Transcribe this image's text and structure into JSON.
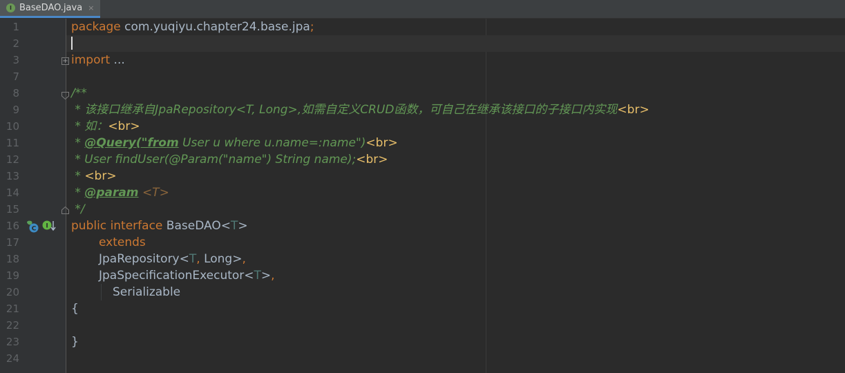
{
  "tab": {
    "label": "BaseDAO.java",
    "icon_letter": "I",
    "close": "×"
  },
  "line_numbers": [
    "1",
    "2",
    "3",
    "7",
    "8",
    "9",
    "10",
    "11",
    "12",
    "13",
    "14",
    "15",
    "16",
    "17",
    "18",
    "19",
    "20",
    "21",
    "22",
    "23",
    "24"
  ],
  "lines": {
    "l1": {
      "kw": "package",
      "pkg": " com.yuqiyu.chapter24.base.jpa",
      "semi": ";"
    },
    "l3": {
      "kw": "import",
      "fold": " ..."
    },
    "l8": "/**",
    "l9": {
      "text": " * 该接口继承自JpaRepository<T, Long>,如需自定义CRUD函数，可自己在继承该接口的子接口内实现",
      "tag": "<br>"
    },
    "l10": {
      "text": " * 如：",
      "tag": "<br>"
    },
    "l11": {
      "star": " * ",
      "anno": "@Query(\"from",
      "text": " User u where u.name=:name\")",
      "tag": "<br>"
    },
    "l12": {
      "text": " * User findUser(@Param(\"name\") String name);",
      "tag": "<br>"
    },
    "l13": {
      "text": " * ",
      "tag": "<br>"
    },
    "l14": {
      "star": " * ",
      "anno": "@param",
      "space": " ",
      "tparam": "<T>"
    },
    "l15": " */",
    "l16": {
      "kw1": "public",
      "kw2": "interface",
      "name": " BaseDAO<",
      "tparam": "T",
      "close": ">"
    },
    "l17": {
      "kw": "extends"
    },
    "l18": {
      "name": "JpaRepository<",
      "tparam": "T",
      "comma": ",",
      "rest": " Long>",
      "comma2": ","
    },
    "l19": {
      "name": "JpaSpecificationExecutor<",
      "tparam": "T",
      "close": ">",
      "comma": ","
    },
    "l20": "Serializable",
    "l21": "{",
    "l23": "}"
  },
  "colors": {
    "keyword": "#cc7832",
    "doc": "#629755",
    "text": "#a9b7c6",
    "type_param": "#507874",
    "tag": "#e8bf6a"
  },
  "icons": {
    "fold_expand": "plus-box-icon",
    "fold_collapse": "minus-box-icon",
    "implemented": "implemented-interface-icon",
    "overridden": "has-implementations-icon"
  }
}
